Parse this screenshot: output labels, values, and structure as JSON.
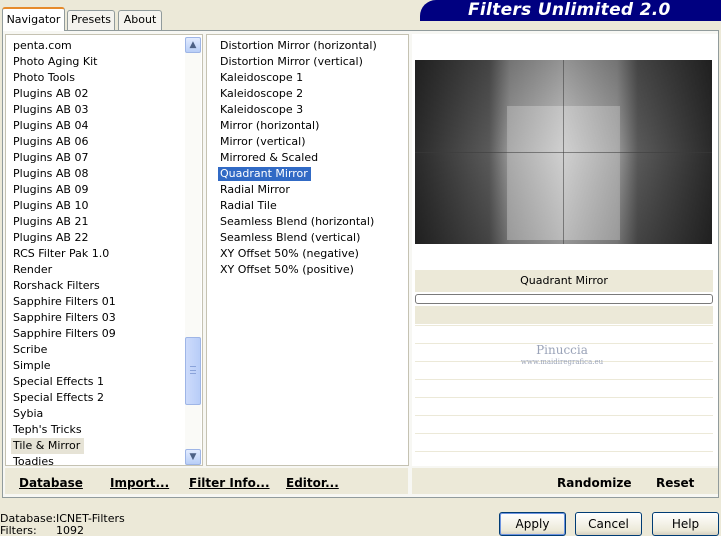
{
  "tabs": [
    {
      "label": "Navigator"
    },
    {
      "label": "Presets"
    },
    {
      "label": "About"
    }
  ],
  "app_title": "Filters Unlimited 2.0",
  "categories": [
    "penta.com",
    "Photo Aging Kit",
    "Photo Tools",
    "Plugins AB 02",
    "Plugins AB 03",
    "Plugins AB 04",
    "Plugins AB 06",
    "Plugins AB 07",
    "Plugins AB 08",
    "Plugins AB 09",
    "Plugins AB 10",
    "Plugins AB 21",
    "Plugins AB 22",
    "RCS Filter Pak 1.0",
    "Render",
    "Rorshack Filters",
    "Sapphire Filters 01",
    "Sapphire Filters 03",
    "Sapphire Filters 09",
    "Scribe",
    "Simple",
    "Special Effects 1",
    "Special Effects 2",
    "Sybia",
    "Teph's Tricks",
    "Tile & Mirror",
    "Toadies"
  ],
  "selected_category": "Tile & Mirror",
  "filters": [
    "Distortion Mirror (horizontal)",
    "Distortion Mirror (vertical)",
    "Kaleidoscope 1",
    "Kaleidoscope 2",
    "Kaleidoscope 3",
    "Mirror (horizontal)",
    "Mirror (vertical)",
    "Mirrored & Scaled",
    "Quadrant Mirror",
    "Radial Mirror",
    "Radial Tile",
    "Seamless Blend (horizontal)",
    "Seamless Blend (vertical)",
    "XY Offset 50% (negative)",
    "XY Offset 50% (positive)"
  ],
  "selected_filter": "Quadrant Mirror",
  "preview": {
    "filter_name": "Quadrant Mirror",
    "progress": 0,
    "watermark_name": "Pinuccia",
    "watermark_url": "www.maidiregrafica.eu"
  },
  "toolbar": {
    "database": "Database",
    "import": "Import...",
    "filter_info": "Filter Info...",
    "editor": "Editor...",
    "randomize": "Randomize",
    "reset": "Reset"
  },
  "status": {
    "database_label": "Database:",
    "database_value": "ICNET-Filters",
    "filters_label": "Filters:",
    "filters_value": "1092"
  },
  "buttons": {
    "apply": "Apply",
    "cancel": "Cancel",
    "help": "Help"
  }
}
